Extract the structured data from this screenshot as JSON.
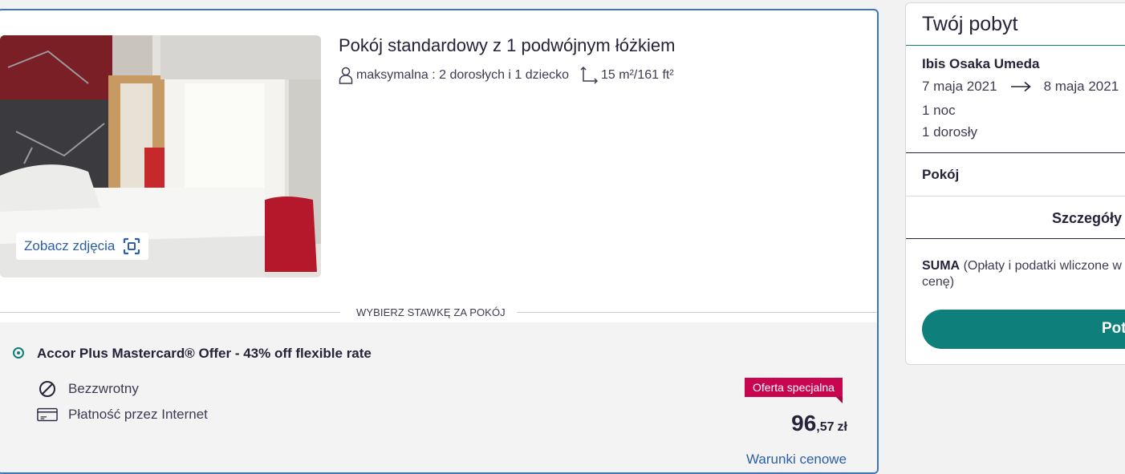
{
  "room": {
    "title": "Pokój standardowy z 1 podwójnym łóżkiem",
    "occupancy": "maksymalna : 2 dorosłych i 1 dziecko",
    "size": "15 m²/161 ft²",
    "photos_button": "Zobacz zdjęcia"
  },
  "rates_divider": "WYBIERZ STAWKĘ ZA POKÓJ",
  "rate": {
    "name": "Accor Plus Mastercard® Offer - 43% off flexible rate",
    "conditions": [
      "Bezzwrotny",
      "Płatność przez Internet"
    ],
    "badge": "Oferta specjalna",
    "price_integer": "96",
    "price_decimal": ",57",
    "currency": "zł",
    "terms_link": "Warunki cenowe"
  },
  "stay": {
    "title": "Twój pobyt",
    "hotel": "Ibis Osaka Umeda",
    "check_in": "7 maja 2021",
    "check_out": "8 maja 2021",
    "nights": "1 noc",
    "guests": "1 dorosły",
    "room_label": "Pokój",
    "details": "Szczegóły",
    "total_label": "SUMA",
    "total_note": "(Opłaty i podatki wliczone w cenę)",
    "confirm": "Pot"
  },
  "colors": {
    "accent_blue": "#3a74c4",
    "link_blue": "#2a5fa8",
    "teal": "#0e7f7a",
    "badge_red": "#c7064f"
  },
  "icons": [
    "person-icon",
    "area-icon",
    "gallery-icon",
    "no-refund-icon",
    "card-icon",
    "arrow-right-icon"
  ]
}
